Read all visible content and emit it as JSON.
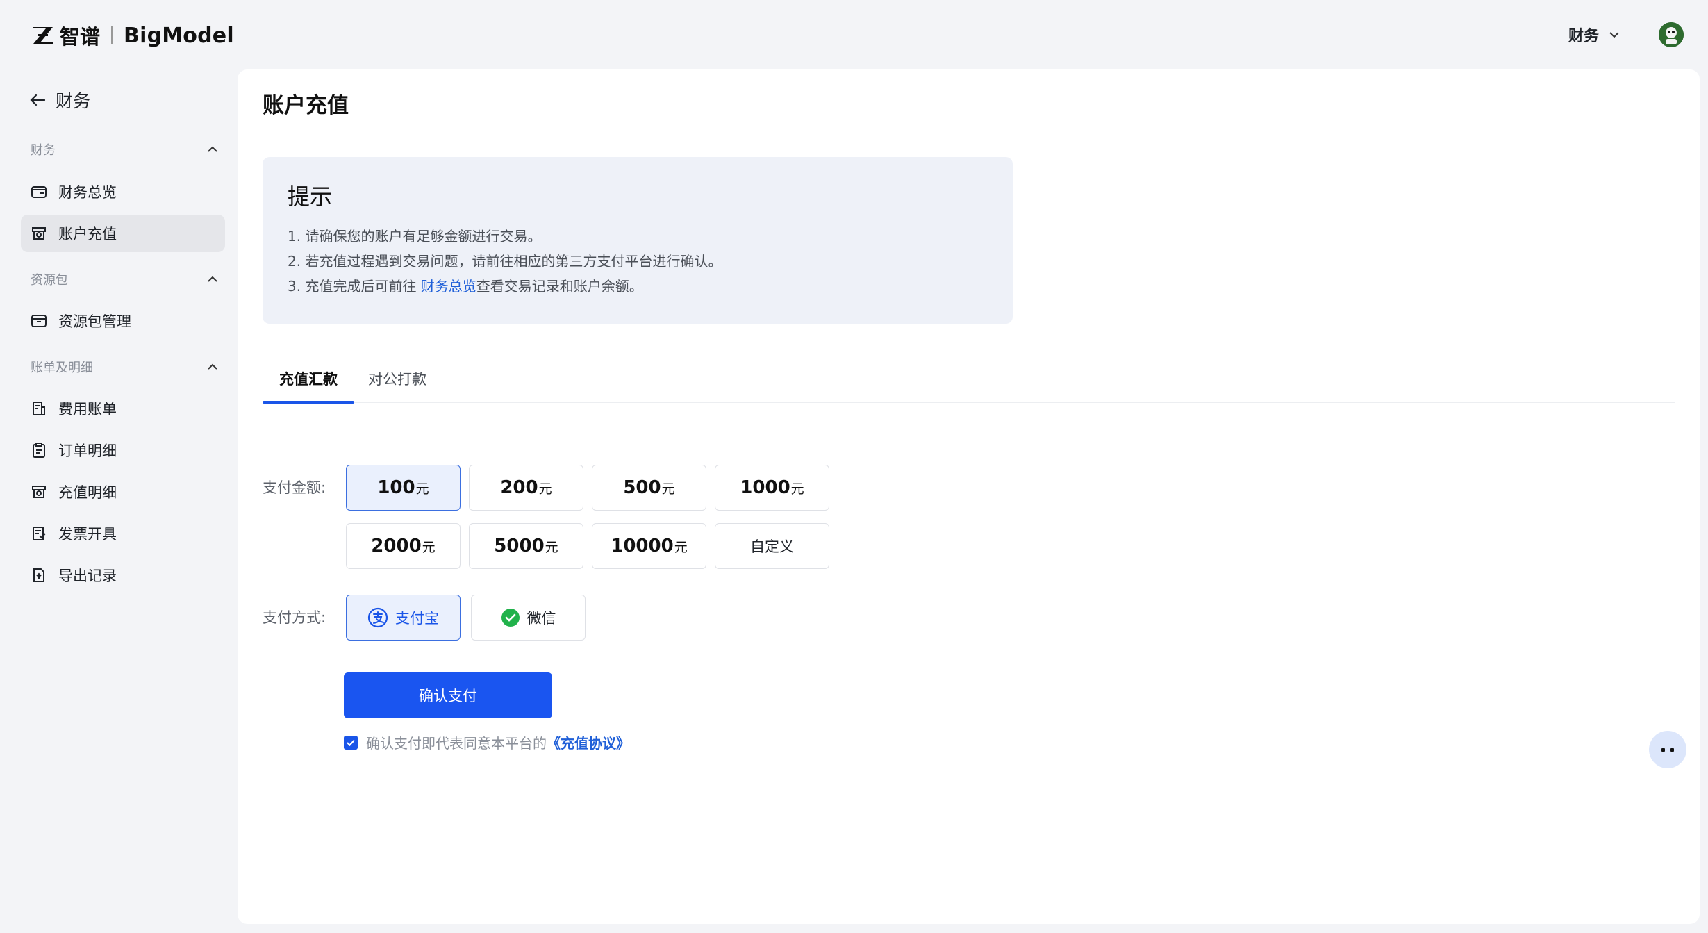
{
  "header": {
    "brand_cn": "智谱",
    "brand_en": "BigModel",
    "org_label": "财务"
  },
  "sidebar": {
    "back_label": "财务",
    "groups": [
      {
        "title": "财务",
        "items": [
          {
            "label": "财务总览"
          },
          {
            "label": "账户充值"
          }
        ]
      },
      {
        "title": "资源包",
        "items": [
          {
            "label": "资源包管理"
          }
        ]
      },
      {
        "title": "账单及明细",
        "items": [
          {
            "label": "费用账单"
          },
          {
            "label": "订单明细"
          },
          {
            "label": "充值明细"
          },
          {
            "label": "发票开具"
          },
          {
            "label": "导出记录"
          }
        ]
      }
    ],
    "active_item": "账户充值"
  },
  "main": {
    "title": "账户充值",
    "tips": {
      "title": "提示",
      "line1": "1. 请确保您的账户有足够金额进行交易。",
      "line2": "2. 若充值过程遇到交易问题，请前往相应的第三方支付平台进行确认。",
      "line3_prefix": "3. 充值完成后可前往 ",
      "line3_link": "财务总览",
      "line3_suffix": "查看交易记录和账户余额。"
    },
    "tabs": [
      {
        "label": "充值汇款"
      },
      {
        "label": "对公打款"
      }
    ],
    "amount_label": "支付金额:",
    "unit": "元",
    "amounts": [
      {
        "value": "100"
      },
      {
        "value": "200"
      },
      {
        "value": "500"
      },
      {
        "value": "1000"
      },
      {
        "value": "2000"
      },
      {
        "value": "5000"
      },
      {
        "value": "10000"
      }
    ],
    "custom_label": "自定义",
    "selected_amount": "100",
    "method_label": "支付方式:",
    "methods": [
      {
        "label": "支付宝"
      },
      {
        "label": "微信"
      }
    ],
    "selected_method": "支付宝",
    "confirm_label": "确认支付",
    "agree_text": "确认支付即代表同意本平台的",
    "agree_link": "《充值协议》",
    "agree_checked": true
  },
  "colors": {
    "accent": "#1a55f0",
    "selected_bg": "#eaf0fd",
    "link": "#1f5fd8",
    "tips_bg": "#eef1f8"
  }
}
